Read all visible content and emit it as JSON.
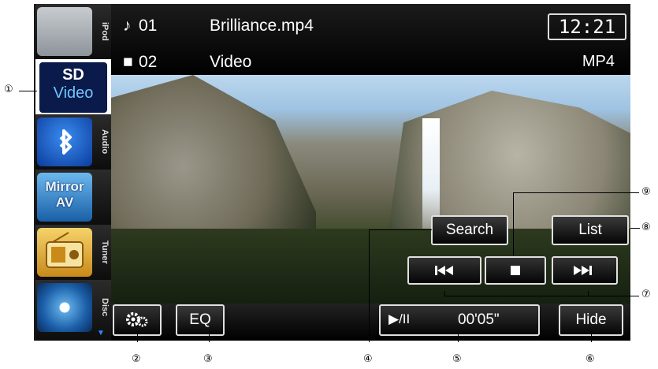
{
  "sidebar": {
    "items": [
      {
        "label": "iPod",
        "icon": "ipod-dock-icon"
      },
      {
        "label_top": "SD",
        "label_bottom": "Video",
        "active": true
      },
      {
        "label": "Audio",
        "icon": "bluetooth-icon"
      },
      {
        "label_top": "Mirror",
        "label_bottom": "AV"
      },
      {
        "label": "Tuner",
        "icon": "radio-icon"
      },
      {
        "label": "Disc",
        "icon": "disc-icon"
      }
    ]
  },
  "header": {
    "track_num": "01",
    "track_title": "Brilliance.mp4",
    "folder_num": "02",
    "folder_title": "Video",
    "clock": "12:21",
    "format": "MP4"
  },
  "controls": {
    "search_label": "Search",
    "list_label": "List",
    "eq_label": "EQ",
    "play_time": "00'05\"",
    "hide_label": "Hide"
  },
  "callouts": [
    "①",
    "②",
    "③",
    "④",
    "⑤",
    "⑥",
    "⑦",
    "⑧",
    "⑨"
  ]
}
